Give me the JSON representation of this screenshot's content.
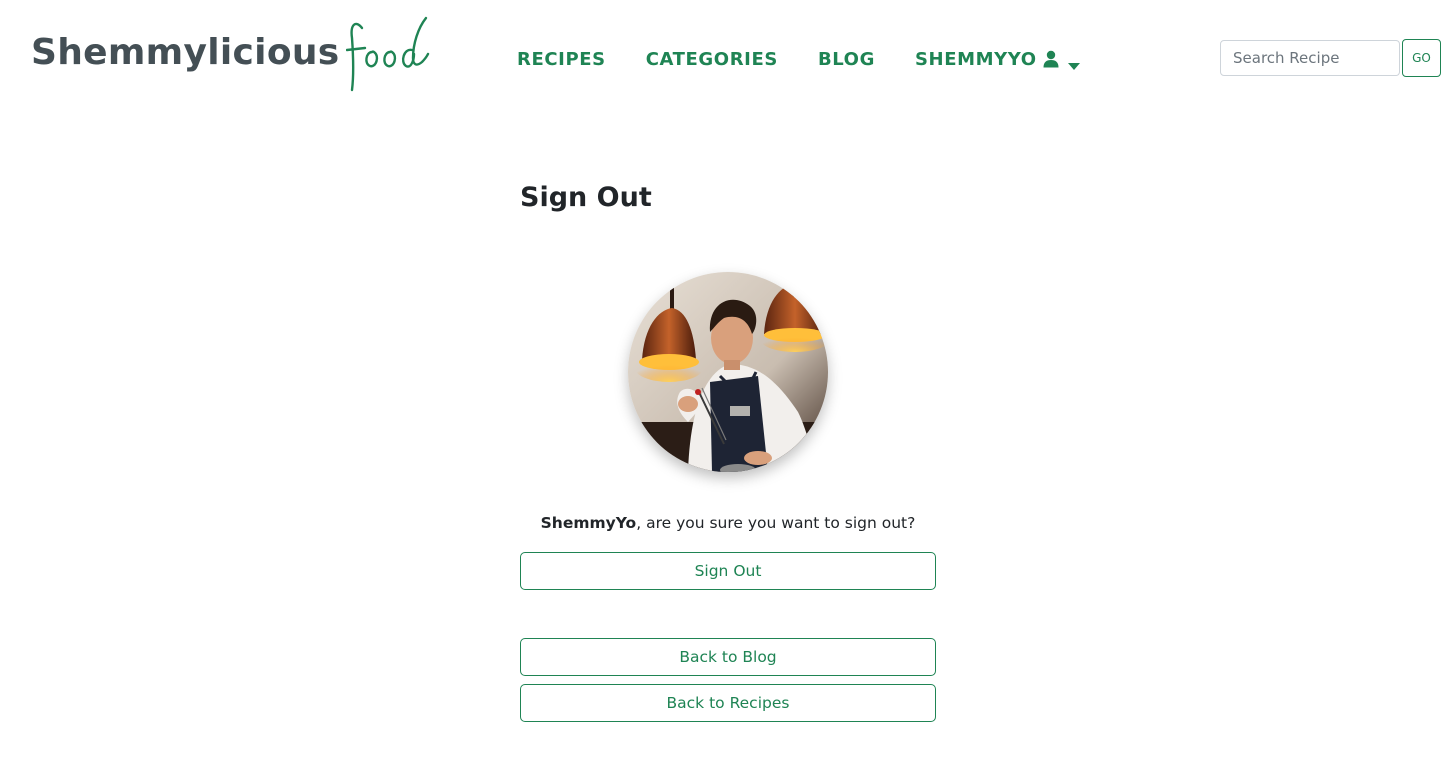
{
  "brand": {
    "main": "Shemmylicious",
    "script": "food",
    "color_main": "#444f55",
    "color_accent": "#1f8454"
  },
  "nav": {
    "items": [
      {
        "label": "RECIPES"
      },
      {
        "label": "CATEGORIES"
      },
      {
        "label": "BLOG"
      },
      {
        "label": "SHEMMYYO",
        "icon": "user-icon",
        "dropdown": "caret-down-icon"
      }
    ]
  },
  "search": {
    "placeholder": "Search Recipe",
    "value": "",
    "button_label": "GO"
  },
  "main": {
    "title": "Sign Out",
    "avatar_icon": "chef-profile-photo",
    "confirm_user": "ShemmyYo",
    "confirm_rest": ", are you sure you want to sign out?",
    "signout_label": "Sign Out",
    "back_blog_label": "Back to Blog",
    "back_recipes_label": "Back to Recipes"
  }
}
